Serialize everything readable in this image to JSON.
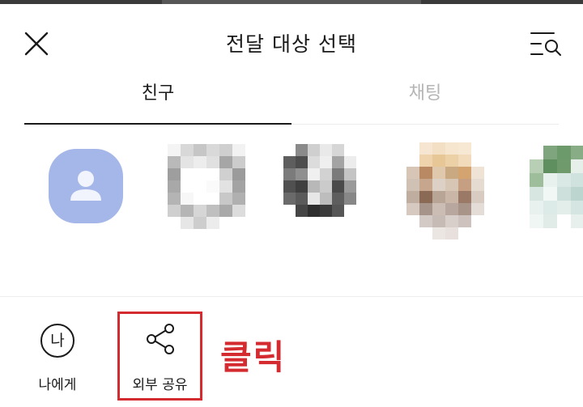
{
  "header": {
    "title": "전달 대상 선택",
    "close_icon": "close-icon",
    "search_icon": "list-search-icon"
  },
  "tabs": [
    {
      "label": "친구",
      "active": true
    },
    {
      "label": "채팅",
      "active": false
    }
  ],
  "colors": {
    "accent_active": "#1a1a1a",
    "tab_inactive": "#b5b5b5",
    "default_avatar": "#a4b7e8",
    "annotation_red": "#d42b30"
  },
  "friends": [
    {
      "avatar": "default-profile"
    },
    {
      "avatar": "pixelated"
    },
    {
      "avatar": "pixelated"
    },
    {
      "avatar": "pixelated"
    },
    {
      "avatar": "pixelated"
    }
  ],
  "actions": {
    "to_me": {
      "label": "나에게",
      "icon_glyph": "나"
    },
    "external_share": {
      "label": "외부 공유",
      "icon": "share-icon"
    }
  },
  "annotation": {
    "text": "클릭"
  }
}
